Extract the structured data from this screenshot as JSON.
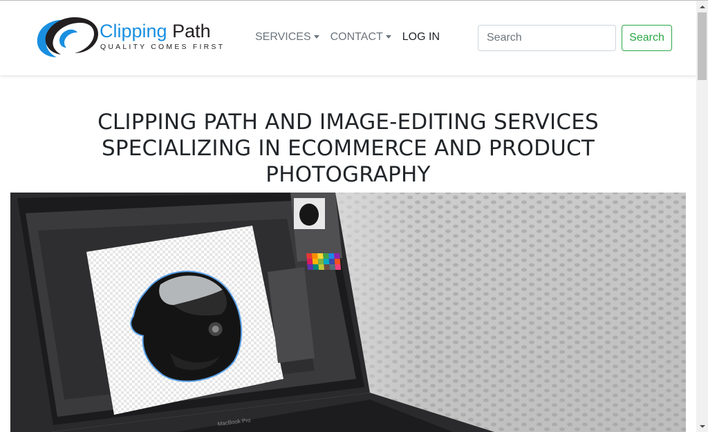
{
  "brand": {
    "name_part1": "Clipping",
    "name_part2": "Path",
    "tagline": "QUALITY COMES FIRST",
    "colors": {
      "blue": "#1a8fe0",
      "dark": "#231f20"
    }
  },
  "nav": {
    "items": [
      {
        "label": "SERVICES",
        "dropdown": true
      },
      {
        "label": "CONTACT",
        "dropdown": true
      },
      {
        "label": "LOG IN",
        "dropdown": false
      }
    ]
  },
  "search": {
    "placeholder": "Search",
    "value": "",
    "button_label": "Search",
    "button_color": "#28a745"
  },
  "hero": {
    "title_line1": "CLIPPING PATH AND IMAGE-EDITING SERVICES",
    "title_line2": "SPECIALIZING IN ECOMMERCE AND PRODUCT",
    "title_line3": "PHOTOGRAPHY",
    "image": {
      "description_icon": "laptop-photo-editing-image",
      "laptop_label": "MacBook Pro"
    }
  }
}
